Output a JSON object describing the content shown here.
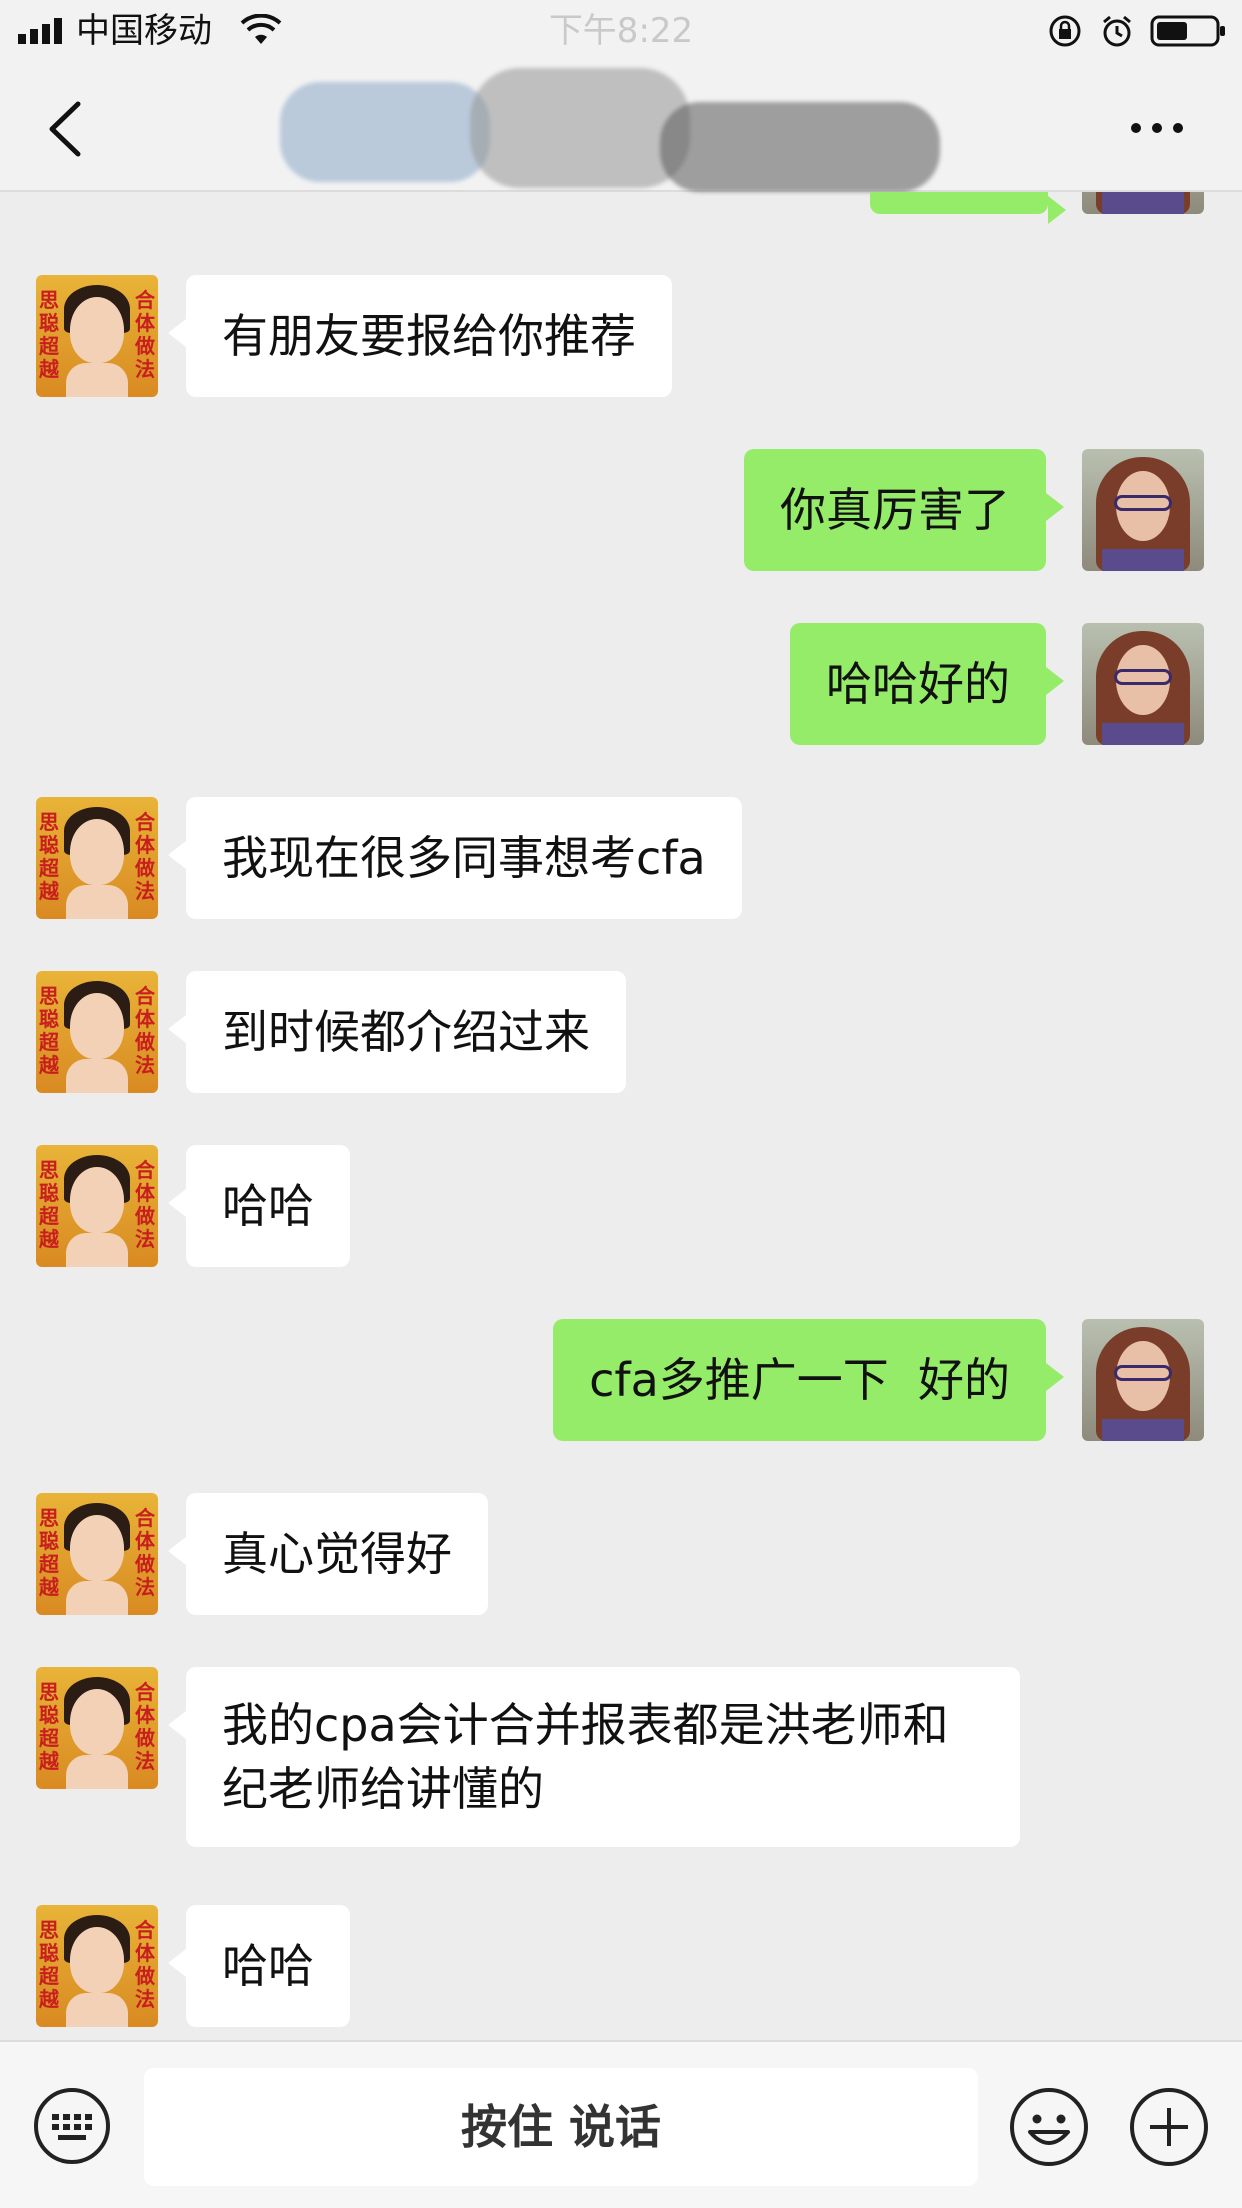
{
  "status_bar": {
    "carrier": "中国移动",
    "time": "下午8:22"
  },
  "nav": {
    "title_obscured": true
  },
  "avatar_other_text": {
    "left": "思聪超越",
    "right": "合体做法"
  },
  "messages": [
    {
      "side": "other",
      "text": "有朋友要报给你推荐"
    },
    {
      "side": "self",
      "text": "你真厉害了"
    },
    {
      "side": "self",
      "text": "哈哈好的"
    },
    {
      "side": "other",
      "text": "我现在很多同事想考cfa"
    },
    {
      "side": "other",
      "text": "到时候都介绍过来"
    },
    {
      "side": "other",
      "text": "哈哈"
    },
    {
      "side": "self",
      "text": "cfa多推广一下  好的"
    },
    {
      "side": "other",
      "text": "真心觉得好"
    },
    {
      "side": "other",
      "text": "我的cpa会计合并报表都是洪老师和纪老师给讲懂的"
    },
    {
      "side": "other",
      "text": "哈哈"
    }
  ],
  "input_bar": {
    "hold_to_talk": "按住 说话"
  },
  "icons": {
    "signal": "signal-icon",
    "wifi": "wifi-icon",
    "lock": "orientation-lock-icon",
    "alarm": "alarm-icon",
    "battery": "battery-icon",
    "back": "back-arrow-icon",
    "more": "more-icon",
    "keyboard": "keyboard-icon",
    "emoji": "emoji-icon",
    "plus": "plus-icon"
  },
  "colors": {
    "self_bubble": "#95ec69",
    "other_bubble": "#ffffff",
    "background": "#ededed"
  }
}
